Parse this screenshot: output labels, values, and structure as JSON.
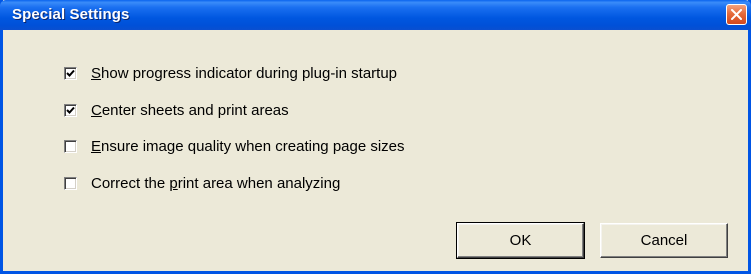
{
  "dialog": {
    "title": "Special Settings"
  },
  "options": [
    {
      "pre": "",
      "key": "S",
      "post": "how progress indicator during plug-in startup",
      "checked": true
    },
    {
      "pre": "",
      "key": "C",
      "post": "enter sheets and print areas",
      "checked": true
    },
    {
      "pre": "",
      "key": "E",
      "post": "nsure image quality when creating page sizes",
      "checked": false
    },
    {
      "pre": "Correct the ",
      "key": "p",
      "post": "rint area when analyzing",
      "checked": false
    }
  ],
  "buttons": {
    "ok_label": "OK",
    "cancel_label": "Cancel"
  },
  "colors": {
    "titlebar": "#0055e5",
    "close": "#e56b3c",
    "face": "#ece9d8"
  },
  "icons": {
    "close": "close-icon",
    "check": "checkmark-icon"
  }
}
